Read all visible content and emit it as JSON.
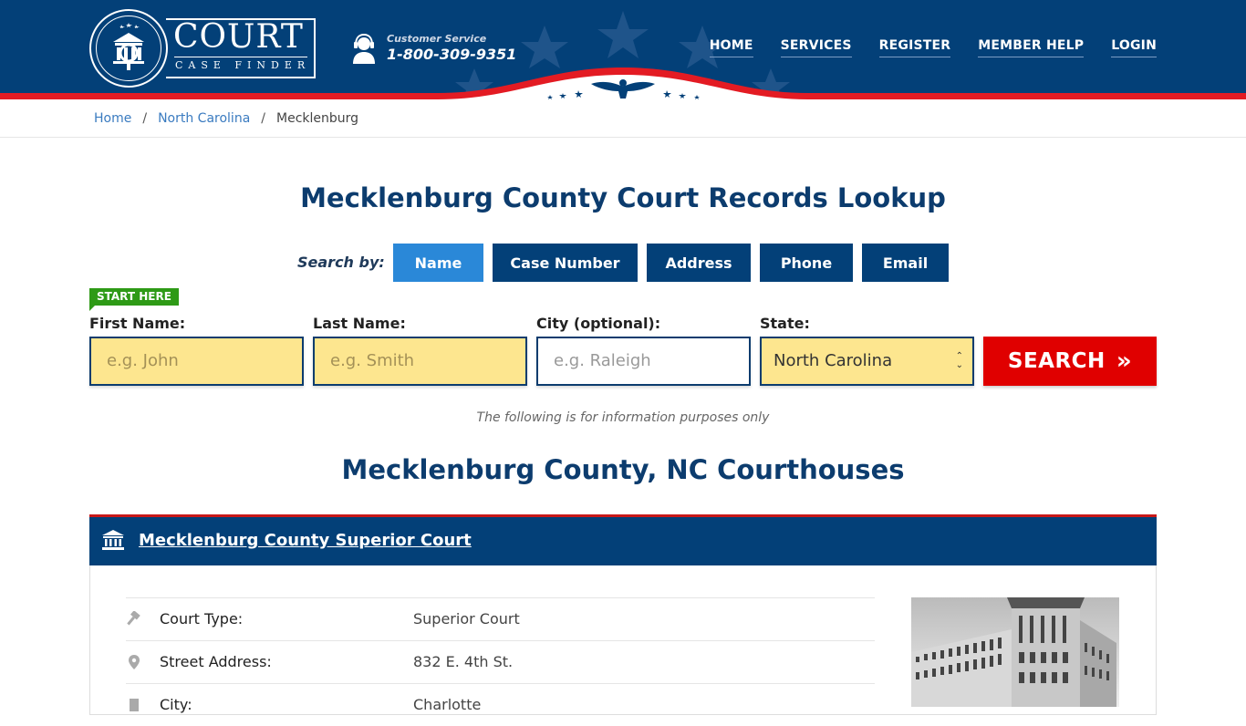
{
  "brand": {
    "name": "COURT",
    "tagline": "CASE FINDER"
  },
  "customer_service": {
    "label": "Customer Service",
    "phone": "1-800-309-9351"
  },
  "nav": [
    {
      "label": "HOME"
    },
    {
      "label": "SERVICES"
    },
    {
      "label": "REGISTER"
    },
    {
      "label": "MEMBER HELP"
    },
    {
      "label": "LOGIN"
    }
  ],
  "breadcrumb": [
    {
      "label": "Home"
    },
    {
      "label": "North Carolina"
    },
    {
      "label": "Mecklenburg"
    }
  ],
  "page_title": "Mecklenburg County Court Records Lookup",
  "search": {
    "search_by_label": "Search by:",
    "tabs": [
      {
        "label": "Name",
        "active": true
      },
      {
        "label": "Case Number"
      },
      {
        "label": "Address"
      },
      {
        "label": "Phone"
      },
      {
        "label": "Email"
      }
    ],
    "start_here": "START HERE",
    "fields": {
      "first_name": {
        "label": "First Name:",
        "placeholder": "e.g. John"
      },
      "last_name": {
        "label": "Last Name:",
        "placeholder": "e.g. Smith"
      },
      "city": {
        "label": "City (optional):",
        "placeholder": "e.g.  Raleigh"
      },
      "state": {
        "label": "State:",
        "value": "North Carolina"
      }
    },
    "button_label": "SEARCH",
    "button_icon": "»",
    "note": "The following is for information purposes only"
  },
  "section_title": "Mecklenburg County, NC Courthouses",
  "courthouse": {
    "name": "Mecklenburg County Superior Court",
    "details": [
      {
        "icon": "gavel-icon",
        "key": "Court Type:",
        "value": "Superior Court"
      },
      {
        "icon": "map-pin-icon",
        "key": "Street Address:",
        "value": "832 E. 4th St."
      },
      {
        "icon": "building-icon",
        "key": "City:",
        "value": "Charlotte"
      }
    ]
  },
  "colors": {
    "primary": "#034078",
    "accent_red": "#e00000",
    "active_tab": "#2a88d8",
    "input_yellow": "#fde68f",
    "start_green": "#2e9a16"
  }
}
